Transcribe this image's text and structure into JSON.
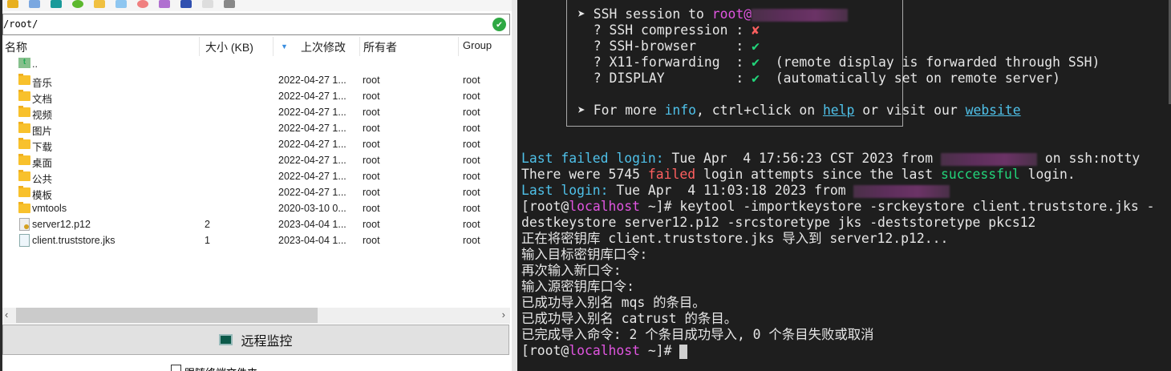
{
  "sftp": {
    "path": "/root/",
    "columns": {
      "name": "名称",
      "size": "大小 (KB)",
      "modified": "上次修改",
      "owner": "所有者",
      "group": "Group"
    },
    "parent": "..",
    "rows": [
      {
        "name": "音乐",
        "size": "",
        "modified": "2022-04-27 1...",
        "owner": "root",
        "group": "root",
        "type": "folder"
      },
      {
        "name": "文档",
        "size": "",
        "modified": "2022-04-27 1...",
        "owner": "root",
        "group": "root",
        "type": "folder"
      },
      {
        "name": "视频",
        "size": "",
        "modified": "2022-04-27 1...",
        "owner": "root",
        "group": "root",
        "type": "folder"
      },
      {
        "name": "图片",
        "size": "",
        "modified": "2022-04-27 1...",
        "owner": "root",
        "group": "root",
        "type": "folder"
      },
      {
        "name": "下载",
        "size": "",
        "modified": "2022-04-27 1...",
        "owner": "root",
        "group": "root",
        "type": "folder"
      },
      {
        "name": "桌面",
        "size": "",
        "modified": "2022-04-27 1...",
        "owner": "root",
        "group": "root",
        "type": "folder"
      },
      {
        "name": "公共",
        "size": "",
        "modified": "2022-04-27 1...",
        "owner": "root",
        "group": "root",
        "type": "folder"
      },
      {
        "name": "模板",
        "size": "",
        "modified": "2022-04-27 1...",
        "owner": "root",
        "group": "root",
        "type": "folder"
      },
      {
        "name": "vmtools",
        "size": "",
        "modified": "2020-03-10 0...",
        "owner": "root",
        "group": "root",
        "type": "folder"
      },
      {
        "name": "server12.p12",
        "size": "2",
        "modified": "2023-04-04 1...",
        "owner": "root",
        "group": "root",
        "type": "cert"
      },
      {
        "name": "client.truststore.jks",
        "size": "1",
        "modified": "2023-04-04 1...",
        "owner": "root",
        "group": "root",
        "type": "file"
      }
    ],
    "monitor_button": "远程监控",
    "follow_label": "跟随终端文件夹"
  },
  "terminal": {
    "ssh_session": "SSH session to ",
    "user": "root@",
    "compression": "? SSH compression : ",
    "browser": "? SSH-browser     : ",
    "x11": "? X11-forwarding  : ",
    "x11_note": "  (remote display is forwarded through SSH)",
    "display": "? DISPLAY         : ",
    "display_note": "  (automatically set on remote server)",
    "cross": "✘",
    "check": "✔",
    "more_1": "For more ",
    "info": "info",
    "more_2": ", ctrl+click on ",
    "help": "help",
    "more_3": " or visit our ",
    "website": "website",
    "failed_label": "Last failed login:",
    "failed_text": " Tue Apr  4 17:56:23 CST 2023 from ",
    "failed_tail": " on ssh:notty",
    "attempts_1": "There were 5745 ",
    "attempts_failed": "failed",
    "attempts_2": " login attempts since the last ",
    "attempts_success": "successful",
    "attempts_3": " login.",
    "last_label": "Last login:",
    "last_text": " Tue Apr  4 11:03:18 2023 from ",
    "prompt_open": "[root@",
    "host": "localhost",
    "prompt_close": " ~]# ",
    "cmd1": "keytool -importkeystore -srckeystore client.truststore.jks -",
    "cmd2": "destkeystore server12.p12 -srcstoretype jks -deststoretype pkcs12",
    "out": [
      "正在将密钥库 client.truststore.jks 导入到 server12.p12...",
      "输入目标密钥库口令:",
      "再次输入新口令:",
      "输入源密钥库口令:",
      "已成功导入别名 mqs 的条目。",
      "已成功导入别名 catrust 的条目。",
      "已完成导入命令: 2 个条目成功导入, 0 个条目失败或取消"
    ]
  }
}
